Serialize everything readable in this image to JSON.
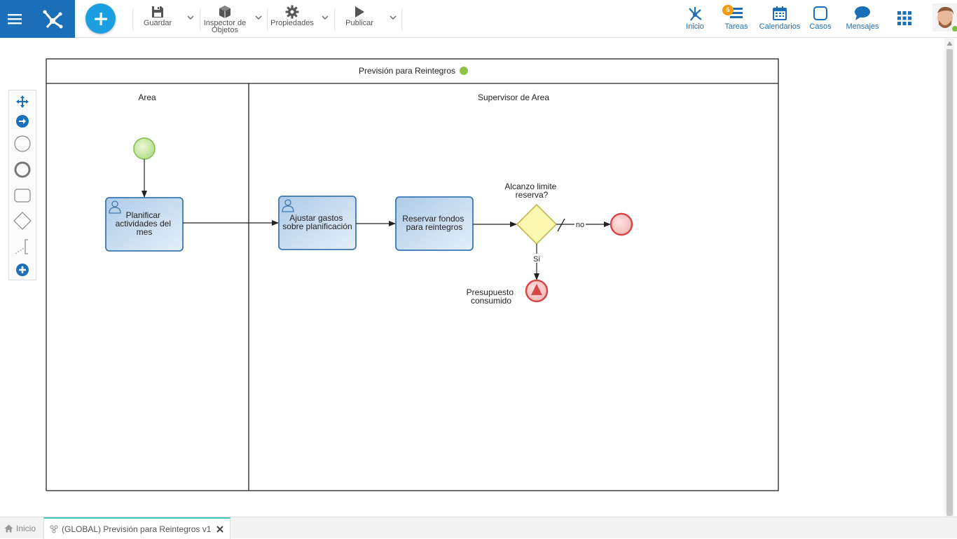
{
  "toolbar": {
    "save_label": "Guardar",
    "inspector_label_line1": "Inspector de",
    "inspector_label_line2": "Objetos",
    "properties_label": "Propiedades",
    "publish_label": "Publicar"
  },
  "nav": {
    "home_label": "Inicio",
    "tasks_label": "Tareas",
    "tasks_badge": "6",
    "calendars_label": "Calendarios",
    "cases_label": "Casos",
    "messages_label": "Mensajes"
  },
  "diagram": {
    "pool_title": "Previsión para Reintegros",
    "lane_1_title": "Area",
    "lane_2_title": "Supervisor de Area",
    "task_1": [
      "Planificar",
      "actividades del",
      "mes"
    ],
    "task_2": [
      "Ajustar gastos",
      "sobre planificación"
    ],
    "task_3": [
      "Reservar fondos",
      "para reintegros"
    ],
    "gateway_label": [
      "Alcanzo limite",
      "reserva?"
    ],
    "flow_no_label": "no",
    "flow_si_label": "Si",
    "end_event_label": [
      "Presupuesto",
      "consumido"
    ]
  },
  "colors": {
    "brand": "#1a6fb8",
    "add_button": "#1c9fe0",
    "active_tab_accent": "#3cc8b4",
    "task_fill": "#c6dcf0",
    "task_stroke": "#3a78b4",
    "start_event": "#a8d67a",
    "end_event": "#e06060",
    "gateway_fill": "#fbf7b0"
  },
  "bottom_tabs": {
    "home_label": "Inicio",
    "active_tab_label": "(GLOBAL) Previsión para Reintegros v1"
  }
}
